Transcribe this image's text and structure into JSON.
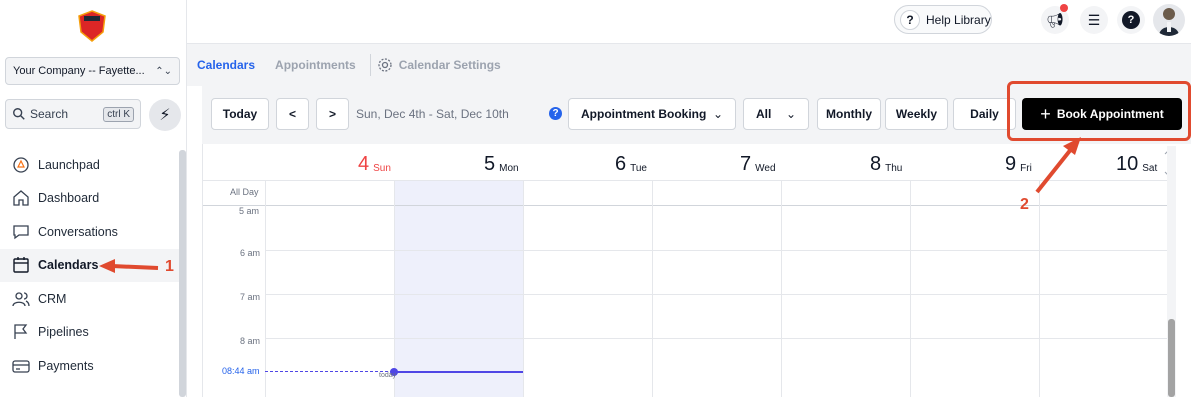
{
  "sidebar": {
    "company": "Your Company -- Fayette...",
    "search_placeholder": "Search",
    "search_shortcut": "ctrl K",
    "items": [
      {
        "label": "Launchpad"
      },
      {
        "label": "Dashboard"
      },
      {
        "label": "Conversations"
      },
      {
        "label": "Calendars"
      },
      {
        "label": "CRM"
      },
      {
        "label": "Pipelines"
      },
      {
        "label": "Payments"
      }
    ]
  },
  "topbar": {
    "help_label": "Help Library"
  },
  "subnav": {
    "tabs": [
      "Calendars",
      "Appointments",
      "Calendar Settings"
    ]
  },
  "toolbar": {
    "today": "Today",
    "prev": "<",
    "next": ">",
    "range": "Sun, Dec 4th - Sat, Dec 10th",
    "calendar_select": "Appointment Booking",
    "filter_select": "All",
    "view_monthly": "Monthly",
    "view_weekly": "Weekly",
    "view_daily": "Daily",
    "book": "Book Appointment"
  },
  "calendar": {
    "days": [
      {
        "num": "4",
        "name": "Sun"
      },
      {
        "num": "5",
        "name": "Mon"
      },
      {
        "num": "6",
        "name": "Tue"
      },
      {
        "num": "7",
        "name": "Wed"
      },
      {
        "num": "8",
        "name": "Thu"
      },
      {
        "num": "9",
        "name": "Fri"
      },
      {
        "num": "10",
        "name": "Sat"
      }
    ],
    "all_day": "All Day",
    "times": [
      "5 am",
      "6 am",
      "7 am",
      "8 am"
    ],
    "now_time": "08:44 am",
    "today_tag": "today"
  },
  "annotations": {
    "one": "1",
    "two": "2",
    "color": "#e04a2f"
  },
  "colors": {
    "accent": "#2563eb",
    "sunday": "#ef4444",
    "now_line": "#4f46e5"
  }
}
